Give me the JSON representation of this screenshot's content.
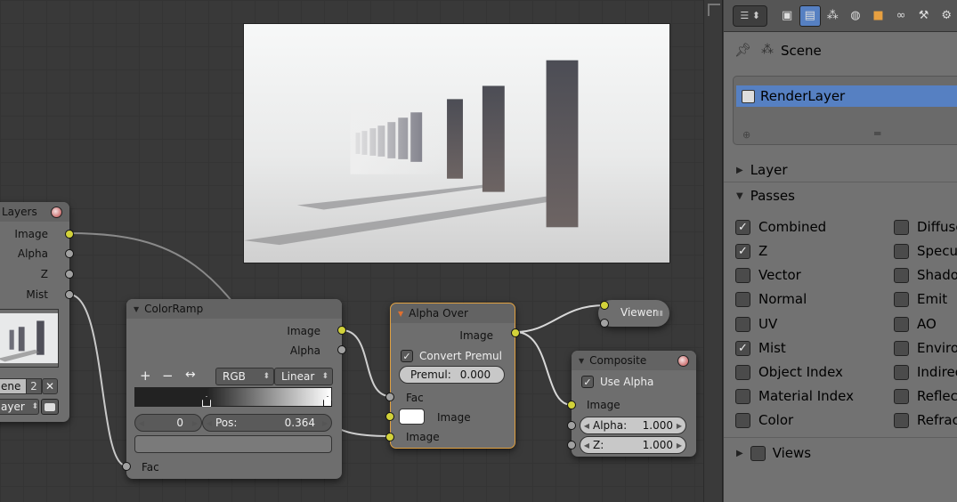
{
  "render_layers_node": {
    "title": "Layers",
    "outputs": [
      "Image",
      "Alpha",
      "Z",
      "Mist"
    ],
    "scene_field": "ene",
    "scene_users": "2",
    "layer_field": "ayer"
  },
  "colorramp_node": {
    "title": "ColorRamp",
    "outputs": [
      "Image",
      "Alpha"
    ],
    "color_mode": "RGB",
    "interpolation": "Linear",
    "add_label": "+",
    "remove_label": "−",
    "flip_label": "↔",
    "stop_index": "0",
    "pos_label": "Pos:",
    "pos_value": "0.364",
    "input": "Fac"
  },
  "alphaover_node": {
    "title": "Alpha Over",
    "output": "Image",
    "convert_premul_label": "Convert Premul",
    "premul_label": "Premul:",
    "premul_value": "0.000",
    "inputs": [
      "Fac",
      "Image",
      "Image"
    ]
  },
  "viewer_node": {
    "title": "Viewer"
  },
  "composite_node": {
    "title": "Composite",
    "use_alpha_label": "Use Alpha",
    "input": "Image",
    "alpha_label": "Alpha:",
    "alpha_value": "1.000",
    "z_label": "Z:",
    "z_value": "1.000"
  },
  "properties": {
    "scene_label": "Scene",
    "render_layer_item": "RenderLayer",
    "layer_section": "Layer",
    "passes_section": "Passes",
    "views_section": "Views",
    "passes_left": [
      {
        "label": "Combined",
        "checked": true
      },
      {
        "label": "Z",
        "checked": true
      },
      {
        "label": "Vector",
        "checked": false
      },
      {
        "label": "Normal",
        "checked": false
      },
      {
        "label": "UV",
        "checked": false
      },
      {
        "label": "Mist",
        "checked": true
      },
      {
        "label": "Object Index",
        "checked": false
      },
      {
        "label": "Material Index",
        "checked": false
      },
      {
        "label": "Color",
        "checked": false
      }
    ],
    "passes_right": [
      {
        "label": "Diffuse",
        "checked": false
      },
      {
        "label": "Specu",
        "checked": false
      },
      {
        "label": "Shado",
        "checked": false
      },
      {
        "label": "Emit",
        "checked": false
      },
      {
        "label": "AO",
        "checked": false
      },
      {
        "label": "Enviro",
        "checked": false
      },
      {
        "label": "Indirec",
        "checked": false
      },
      {
        "label": "Reflec",
        "checked": false
      },
      {
        "label": "Refrac",
        "checked": false
      }
    ]
  },
  "colors": {
    "socket_color": "#d2d23a",
    "active_accent": "#5680c2",
    "alphaover_border": "#e0a040"
  }
}
